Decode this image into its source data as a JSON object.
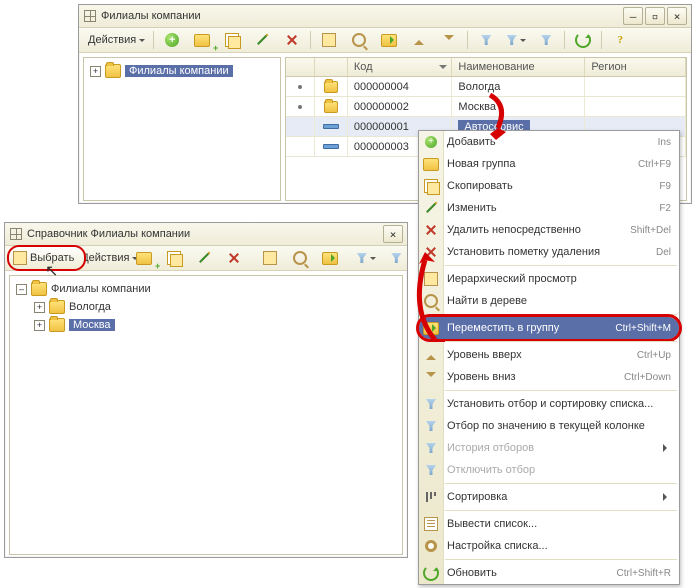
{
  "mainWindow": {
    "title": "Филиалы компании",
    "toolbar": {
      "actions": "Действия"
    },
    "tree": {
      "root": "Филиалы компании"
    },
    "grid": {
      "columns": [
        "Код",
        "Наименование",
        "Регион"
      ],
      "rows": [
        {
          "type": "group",
          "code": "000000004",
          "name": "Вологда",
          "region": ""
        },
        {
          "type": "group",
          "code": "000000002",
          "name": "Москва",
          "region": ""
        },
        {
          "type": "item",
          "code": "000000001",
          "name": "Автосервис",
          "region": "",
          "selected": true
        },
        {
          "type": "item",
          "code": "000000003",
          "name": "",
          "region": ""
        }
      ]
    }
  },
  "pickerWindow": {
    "title": "Справочник Филиалы компании",
    "toolbar": {
      "select": "Выбрать",
      "actions": "Действия"
    },
    "tree": {
      "root": "Филиалы компании",
      "children": [
        "Вологда",
        "Москва"
      ],
      "selected": "Москва"
    }
  },
  "contextMenu": {
    "highlighted": "Переместить в группу",
    "items": [
      {
        "label": "Добавить",
        "shortcut": "Ins"
      },
      {
        "label": "Новая группа",
        "shortcut": "Ctrl+F9"
      },
      {
        "label": "Скопировать",
        "shortcut": "F9"
      },
      {
        "label": "Изменить",
        "shortcut": "F2"
      },
      {
        "label": "Удалить непосредственно",
        "shortcut": "Shift+Del"
      },
      {
        "label": "Установить пометку удаления",
        "shortcut": "Del"
      },
      {
        "label": "Иерархический просмотр",
        "shortcut": ""
      },
      {
        "label": "Найти в дереве",
        "shortcut": ""
      },
      {
        "label": "Переместить в группу",
        "shortcut": "Ctrl+Shift+M"
      },
      {
        "label": "Уровень вверх",
        "shortcut": "Ctrl+Up"
      },
      {
        "label": "Уровень вниз",
        "shortcut": "Ctrl+Down"
      },
      {
        "label": "Установить отбор и сортировку списка...",
        "shortcut": ""
      },
      {
        "label": "Отбор по значению в текущей колонке",
        "shortcut": ""
      },
      {
        "label": "История отборов",
        "shortcut": "",
        "disabled": true,
        "submenu": true
      },
      {
        "label": "Отключить отбор",
        "shortcut": "",
        "disabled": true
      },
      {
        "label": "Сортировка",
        "shortcut": "",
        "submenu": true
      },
      {
        "label": "Вывести список...",
        "shortcut": ""
      },
      {
        "label": "Настройка списка...",
        "shortcut": ""
      },
      {
        "label": "Обновить",
        "shortcut": "Ctrl+Shift+R"
      }
    ]
  },
  "colors": {
    "accent": "#d60000",
    "selection": "#5a6ea8",
    "chrome": "#efecd8"
  }
}
